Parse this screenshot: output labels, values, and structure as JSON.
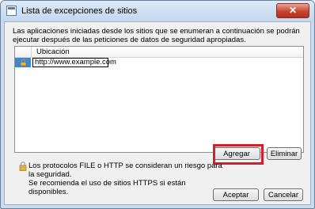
{
  "window": {
    "title": "Lista de excepciones de sitios",
    "close_symbol": "✕"
  },
  "description": "Las aplicaciones iniciadas desde los sitios que se enumeran a continuación se podrán ejecutar después de las peticiones de datos de seguridad apropiadas.",
  "table": {
    "column_header": "Ubicación",
    "rows": [
      {
        "location": "http://www.example.com",
        "icon": "lock-icon"
      }
    ]
  },
  "buttons": {
    "add": "Agregar",
    "remove": "Eliminar",
    "accept": "Aceptar",
    "cancel": "Cancelar"
  },
  "warning": {
    "line1": "Los protocolos FILE o HTTP se consideran un riesgo para la seguridad.",
    "line2": "Se recomienda el uso de sitios HTTPS si están disponibles.",
    "icon": "lock-icon"
  },
  "colors": {
    "highlight": "#d51e2b",
    "selection": "#3a86d8"
  }
}
